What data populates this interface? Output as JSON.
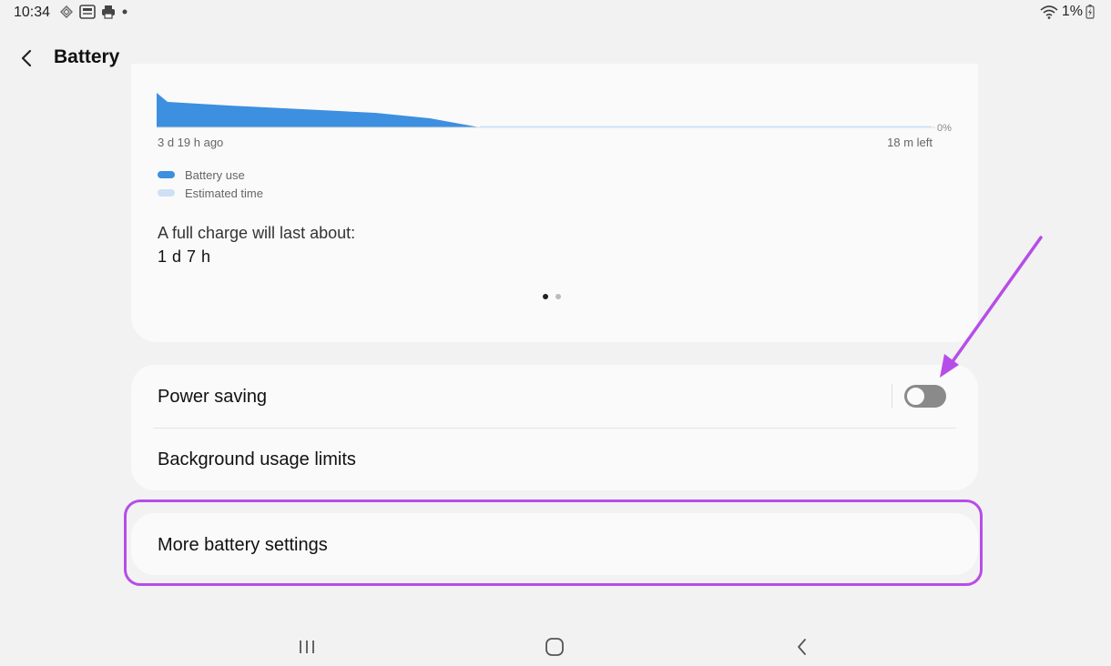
{
  "status_bar": {
    "time": "10:34",
    "battery_percent": "1%",
    "icons": [
      "sync-icon",
      "news-icon",
      "print-icon",
      "dot-icon",
      "wifi-icon",
      "battery-charging-icon"
    ]
  },
  "header": {
    "title": "Battery",
    "back_icon": "chevron-left-icon"
  },
  "chart_card": {
    "percent_label": "0%",
    "x_start_label": "3 d 19 h ago",
    "x_end_label": "18 m left",
    "legend": [
      {
        "label": "Battery use",
        "color": "#3d8fe0"
      },
      {
        "label": "Estimated time",
        "color": "#cfe0f5"
      }
    ],
    "full_charge_label": "A full charge will last about:",
    "full_charge_value": "1 d 7 h",
    "pager": {
      "count": 2,
      "active": 1
    }
  },
  "chart_data": {
    "type": "area",
    "series": [
      {
        "name": "Battery use",
        "values": [
          8,
          6,
          4,
          3,
          2,
          0
        ]
      },
      {
        "name": "Estimated time",
        "values": [
          0,
          0
        ]
      }
    ],
    "xlabel": "",
    "ylabel": "",
    "x_tick_labels": [
      "3 d 19 h ago",
      "18 m left"
    ],
    "y_tick_labels": [
      "0%"
    ]
  },
  "settings_card": {
    "power_saving_label": "Power saving",
    "power_saving_enabled": false,
    "background_limits_label": "Background usage limits"
  },
  "more_card": {
    "label": "More battery settings"
  },
  "annotations": {
    "highlight_color": "#b74de8"
  },
  "nav_bar": {
    "icons": [
      "recents-icon",
      "home-icon",
      "back-icon"
    ]
  }
}
